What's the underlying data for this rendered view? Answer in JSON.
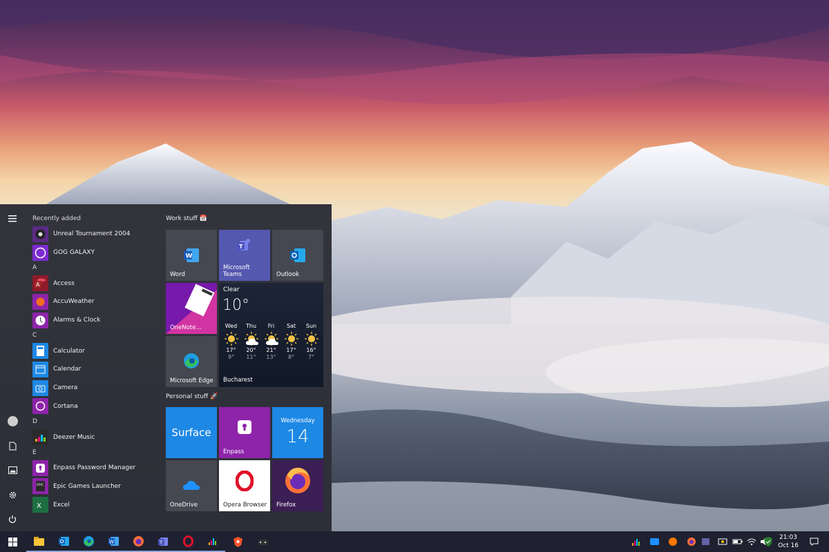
{
  "start_menu": {
    "app_list": {
      "sections": [
        {
          "header": "Recently added",
          "items": [
            {
              "label": "Unreal Tournament 2004",
              "icon": "unreal-tournament-icon"
            },
            {
              "label": "GOG GALAXY",
              "icon": "gog-galaxy-icon"
            }
          ]
        },
        {
          "header": "A",
          "items": [
            {
              "label": "Access",
              "icon": "access-icon"
            },
            {
              "label": "AccuWeather",
              "icon": "accuweather-icon"
            },
            {
              "label": "Alarms & Clock",
              "icon": "alarms-clock-icon"
            }
          ]
        },
        {
          "header": "C",
          "items": [
            {
              "label": "Calculator",
              "icon": "calculator-icon"
            },
            {
              "label": "Calendar",
              "icon": "calendar-icon"
            },
            {
              "label": "Camera",
              "icon": "camera-icon"
            },
            {
              "label": "Cortana",
              "icon": "cortana-icon"
            }
          ]
        },
        {
          "header": "D",
          "items": [
            {
              "label": "Deezer Music",
              "icon": "deezer-icon"
            }
          ]
        },
        {
          "header": "E",
          "items": [
            {
              "label": "Enpass Password Manager",
              "icon": "enpass-icon"
            },
            {
              "label": "Epic Games Launcher",
              "icon": "epic-games-icon"
            },
            {
              "label": "Excel",
              "icon": "excel-icon"
            }
          ]
        }
      ]
    },
    "groups": {
      "work": "Work stuff 📅",
      "personal": "Personal stuff 🚀"
    },
    "tiles": {
      "word": "Word",
      "teams": "Microsoft Teams",
      "outlook": "Outlook",
      "onenote": "OneNote...",
      "edge": "Microsoft Edge",
      "surface": "Surface",
      "enpass": "Enpass",
      "onedrive": "OneDrive",
      "opera": "Opera Browser",
      "firefox": "Firefox"
    },
    "weather": {
      "condition": "Clear",
      "temperature": "10°",
      "city": "Bucharest",
      "forecast": [
        {
          "day": "Wed",
          "high": "17°",
          "low": "9°"
        },
        {
          "day": "Thu",
          "high": "20°",
          "low": "11°"
        },
        {
          "day": "Fri",
          "high": "21°",
          "low": "13°"
        },
        {
          "day": "Sat",
          "high": "17°",
          "low": "8°"
        },
        {
          "day": "Sun",
          "high": "16°",
          "low": "7°"
        }
      ]
    },
    "calendar_tile": {
      "weekday": "Wednesday",
      "day": "14"
    }
  },
  "taskbar": {
    "pinned": [
      "start-icon",
      "file-explorer-icon",
      "outlook-icon",
      "edge-icon",
      "word-icon",
      "firefox-icon",
      "teams-icon",
      "opera-icon",
      "deezer-icon",
      "brave-icon",
      "game-controller-icon"
    ],
    "tray": [
      "deezer-tray-icon",
      "onedrive-icon",
      "avast-icon",
      "firefox-tray-icon",
      "teams-tray-icon",
      "webcam-icon",
      "battery-icon",
      "wifi-icon",
      "volume-muted-icon",
      "security-icon"
    ],
    "time": "21:03",
    "date": "Oct 16"
  },
  "colors": {
    "start_bg": "#2b2d36",
    "tile_gray": "#454850",
    "teams_purple": "#5558af",
    "accent_blue": "#1e88e5",
    "enpass_purple": "#8e24aa",
    "onenote_purple": "#7719aa"
  }
}
